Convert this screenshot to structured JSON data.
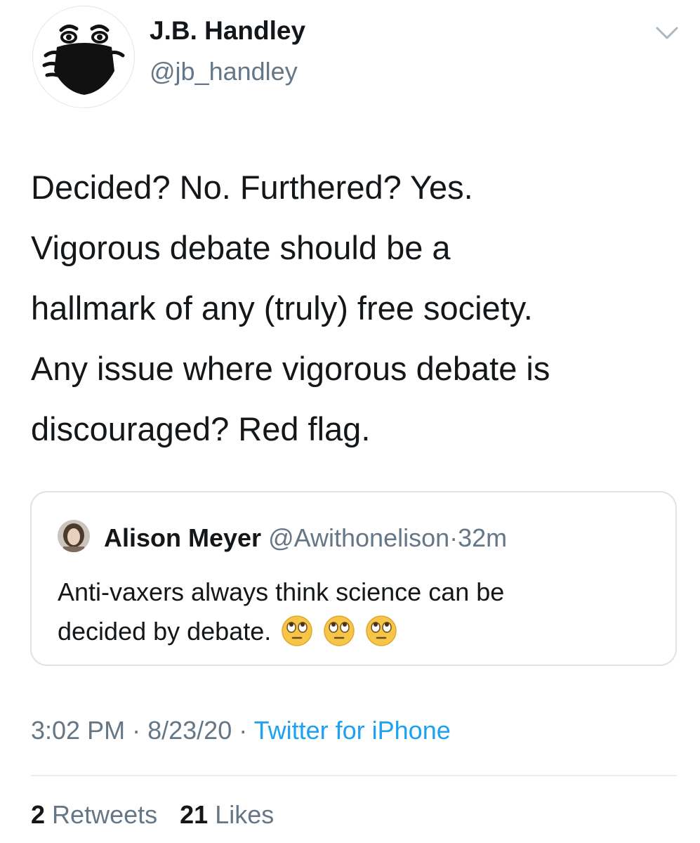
{
  "author": {
    "display_name": "J.B. Handley",
    "handle": "@jb_handley",
    "avatar_icon": "masked-face-icon"
  },
  "tweet": {
    "lines": [
      "Decided? No. Furthered? Yes.",
      "Vigorous debate should be a",
      "hallmark of any (truly) free society.",
      "Any issue where vigorous debate is",
      "discouraged? Red flag."
    ]
  },
  "quoted_tweet": {
    "display_name": "Alison Meyer",
    "handle": "@Awithonelison",
    "separator": "·",
    "time": "32m",
    "lines": [
      "Anti-vaxers always think science can be",
      "decided by debate."
    ],
    "emoji_icon": "face-with-rolling-eyes-icon"
  },
  "meta": {
    "time": "3:02 PM",
    "separator": "·",
    "date": "8/23/20",
    "source": "Twitter for iPhone"
  },
  "stats": {
    "retweets_count": "2",
    "retweets_label": "Retweets",
    "likes_count": "21",
    "likes_label": "Likes"
  },
  "colors": {
    "text_primary": "#14171a",
    "text_secondary": "#657786",
    "link_blue": "#1da1f2",
    "border": "#dfe3e7"
  }
}
